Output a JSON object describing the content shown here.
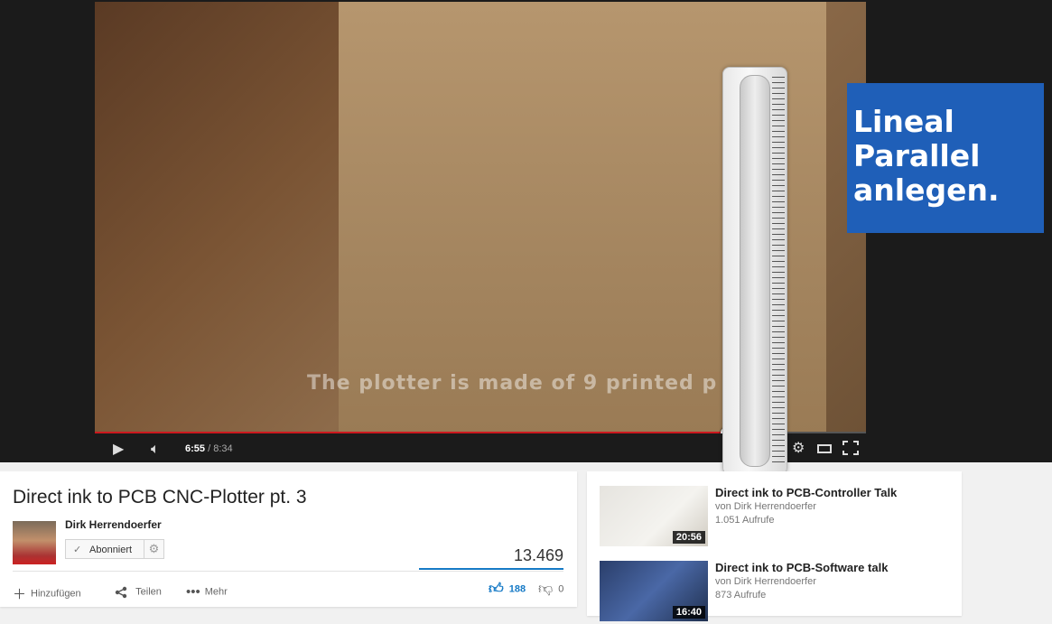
{
  "video": {
    "subtitle": "The plotter is made of 9 printed p",
    "annotation": "Lineal\nParallel\nanlegen.",
    "progress_fraction": 0.82,
    "current_time": "6:55",
    "duration": "8:34",
    "accent_color": "#cc181e",
    "icons": [
      "play-icon",
      "volume-icon",
      "gear-icon",
      "theater-icon",
      "fullscreen-icon"
    ]
  },
  "info": {
    "title": "Direct ink to PCB CNC-Plotter pt. 3",
    "channel": "Dirk Herrendoerfer",
    "subscribe_label": "Abonniert",
    "views": "13.469",
    "actions": {
      "add": "Hinzufügen",
      "share": "Teilen",
      "more": "Mehr"
    },
    "likes": "188",
    "dislikes": "0"
  },
  "recommended": [
    {
      "title": "Direct ink to PCB-Controller Talk",
      "channel": "von Dirk Herrendoerfer",
      "views": "1.051 Aufrufe",
      "duration": "20:56"
    },
    {
      "title": "Direct ink to PCB-Software talk",
      "channel": "von Dirk Herrendoerfer",
      "views": "873 Aufrufe",
      "duration": "16:40"
    }
  ]
}
